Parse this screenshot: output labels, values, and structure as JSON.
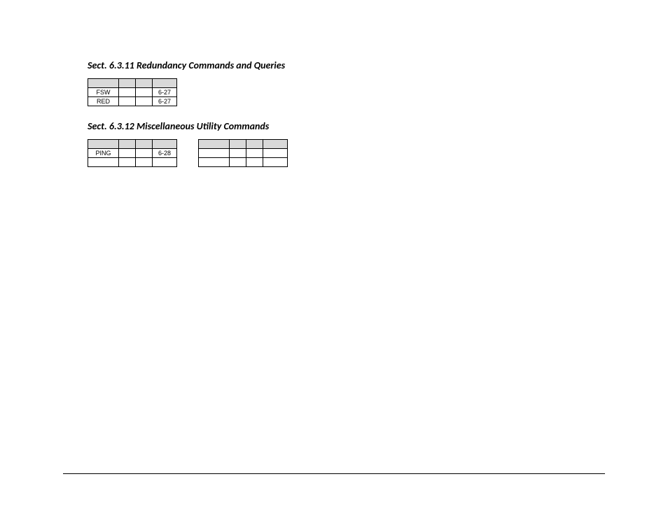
{
  "sections": [
    {
      "title": "Sect. 6.3.11 Redundancy Commands and Queries",
      "tables": [
        {
          "cols": [
            44,
            24,
            24,
            35
          ],
          "header": [
            "",
            "",
            "",
            ""
          ],
          "rows": [
            [
              "FSW",
              "",
              "",
              "6-27"
            ],
            [
              "RED",
              "",
              "",
              "6-27"
            ]
          ]
        }
      ]
    },
    {
      "title": "Sect. 6.3.12 Miscellaneous  Utility Commands",
      "tables": [
        {
          "cols": [
            44,
            24,
            24,
            35
          ],
          "header": [
            "",
            "",
            "",
            ""
          ],
          "rows": [
            [
              "PING",
              "",
              "",
              "6-28"
            ],
            [
              "",
              "",
              "",
              ""
            ]
          ]
        },
        {
          "cols": [
            44,
            24,
            24,
            35
          ],
          "header": [
            "",
            "",
            "",
            ""
          ],
          "rows": [
            [
              "",
              "",
              "",
              ""
            ],
            [
              "",
              "",
              "",
              ""
            ]
          ]
        }
      ]
    }
  ]
}
